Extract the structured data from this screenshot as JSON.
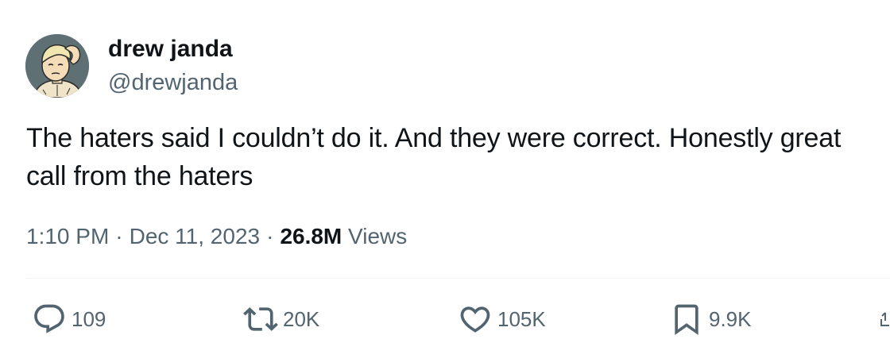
{
  "user": {
    "display_name": "drew janda",
    "handle": "@drewjanda"
  },
  "tweet": {
    "text": "The haters said I couldn’t do it. And they were correct. Honestly great call from the haters",
    "time": "1:10 PM",
    "date": "Dec 11, 2023",
    "separator": "·",
    "views_count": "26.8M",
    "views_label": "Views"
  },
  "actions": {
    "reply": {
      "count": "109",
      "icon": "reply-icon"
    },
    "retweet": {
      "count": "20K",
      "icon": "retweet-icon"
    },
    "like": {
      "count": "105K",
      "icon": "heart-icon"
    },
    "bookmark": {
      "count": "9.9K",
      "icon": "bookmark-icon"
    },
    "share": {
      "icon": "share-icon"
    }
  },
  "colors": {
    "text_primary": "#0f1419",
    "text_secondary": "#536471",
    "divider": "#eff3f4",
    "avatar_background": "#58696c"
  }
}
